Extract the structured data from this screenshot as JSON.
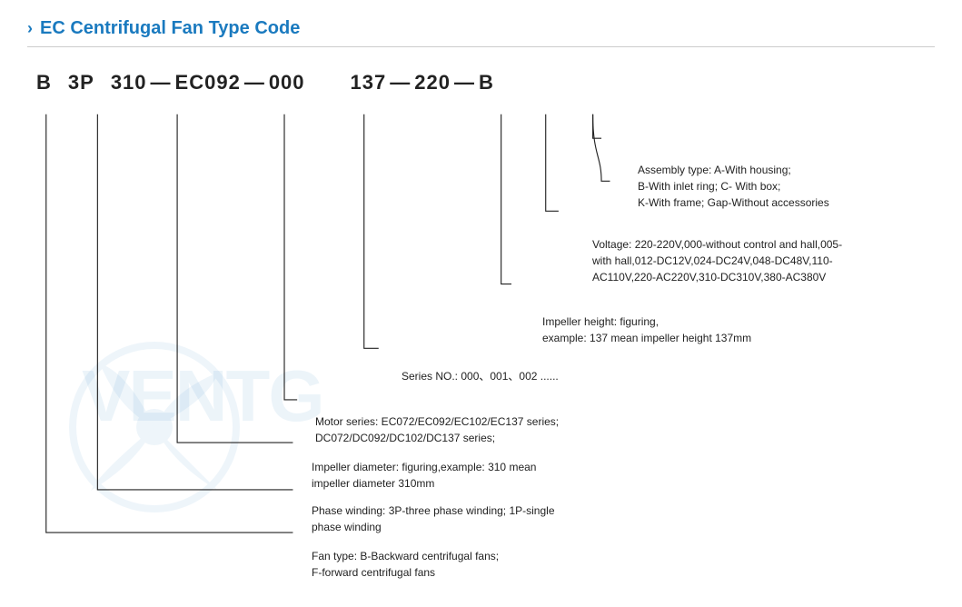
{
  "title": {
    "chevron": "›",
    "text": "EC Centrifugal Fan Type Code"
  },
  "code": {
    "parts": [
      "B",
      "3P",
      "310",
      "EC092",
      "000",
      "137",
      "220",
      "B"
    ],
    "dashes": [
      "—",
      "—",
      "—",
      "—",
      "—",
      "—"
    ]
  },
  "annotations": {
    "assembly": {
      "label": "Assembly type:",
      "text": "A-With housing;\nB-With inlet ring;  C- With box;\nK-With frame; Gap-Without accessories"
    },
    "voltage": {
      "label": "Voltage:",
      "text": "220-220V,000-without control and hall,005-\nwith hall,012-DC12V,024-DC24V,048-DC48V,110-\nAC110V,220-AC220V,310-DC310V,380-AC380V"
    },
    "impeller_height": {
      "label": "Impeller height:",
      "text": "figuring,\nexample: 137 mean impeller height 137mm"
    },
    "series_no": {
      "label": "Series NO.:",
      "text": "000、001、002 ......"
    },
    "motor_series": {
      "label": "Motor series:",
      "text": "EC072/EC092/EC102/EC137 series;\nDC072/DC092/DC102/DC137 series;"
    },
    "impeller_diameter": {
      "label": "Impeller diameter:",
      "text": "figuring,example: 310 mean\nimpeller diameter 310mm"
    },
    "phase_winding": {
      "label": "Phase winding:",
      "text": "3P-three phase winding;  1P-single\nphase winding"
    },
    "fan_type": {
      "label": "Fan type:",
      "text": "B-Backward centrifugal fans;\nF-forward centrifugal fans"
    }
  },
  "watermark_text": "VENTG"
}
